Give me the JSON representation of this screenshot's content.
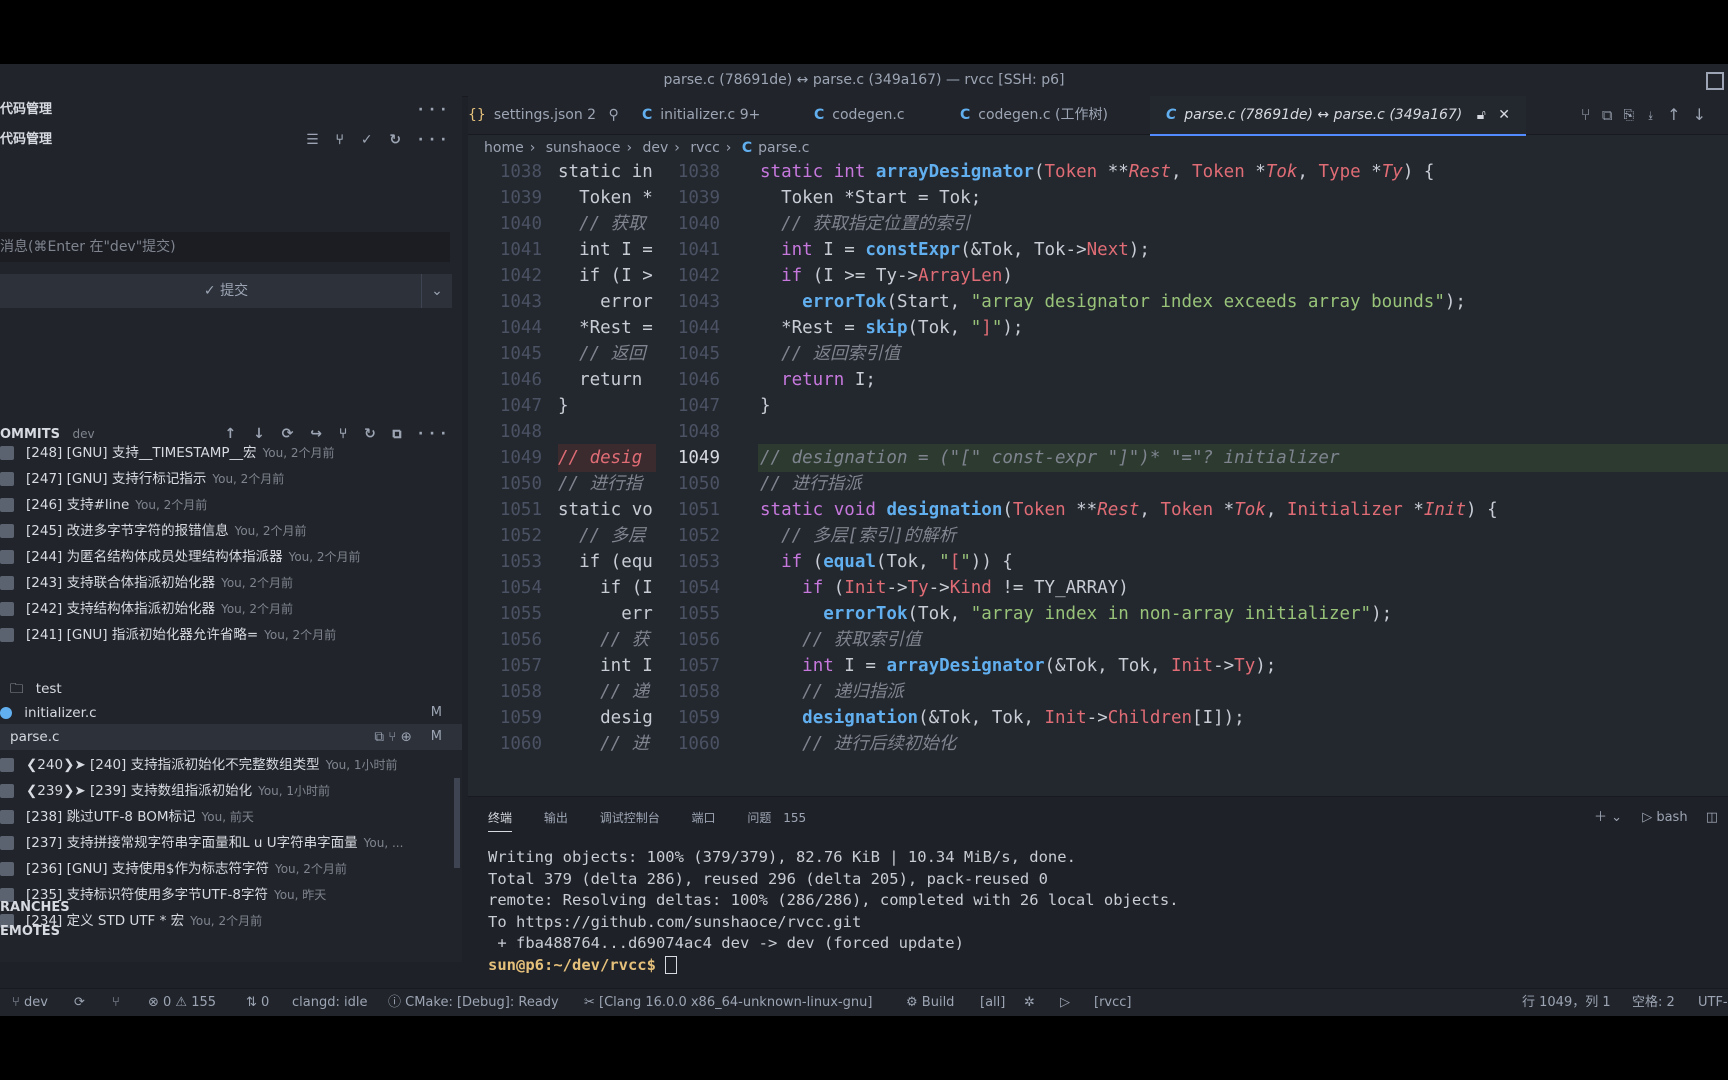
{
  "window": {
    "title": "parse.c (78691de) ↔ parse.c (349a167) — rvcc [SSH: p6]"
  },
  "sidebar": {
    "header": "代码管理",
    "section": "代码管理",
    "commit_placeholder": "消息(⌘Enter 在\"dev\"提交)",
    "commit_button": "✓ 提交",
    "commits_header": "OMMITS",
    "commits_branch": "dev",
    "commits": [
      {
        "text": "[248] [GNU] 支持__TIMESTAMP__宏",
        "meta": "You, 2个月前"
      },
      {
        "text": "[247] [GNU] 支持行标记指示",
        "meta": "You, 2个月前"
      },
      {
        "text": "[246] 支持#line",
        "meta": "You, 2个月前"
      },
      {
        "text": "[245] 改进多字节字符的报错信息",
        "meta": "You, 2个月前"
      },
      {
        "text": "[244] 为匿名结构体成员处理结构体指派器",
        "meta": "You, 2个月前"
      },
      {
        "text": "[243] 支持联合体指派初始化器",
        "meta": "You, 2个月前"
      },
      {
        "text": "[242] 支持结构体指派初始化器",
        "meta": "You, 2个月前"
      },
      {
        "text": "[241] [GNU] 指派初始化器允许省略=",
        "meta": "You, 2个月前"
      }
    ],
    "folder": "test",
    "file1": {
      "name": "initializer.c",
      "badge": "M"
    },
    "file2": {
      "name": "parse.c",
      "badge": "M"
    },
    "commits2": [
      {
        "text": "❮240❯➤ [240] 支持指派初始化不完整数组类型",
        "meta": "You, 1小时前"
      },
      {
        "text": "❮239❯➤ [239] 支持数组指派初始化",
        "meta": "You, 1小时前"
      },
      {
        "text": "[238] 跳过UTF-8 BOM标记",
        "meta": "You, 前天"
      },
      {
        "text": "[237] 支持拼接常规字符串字面量和L u U字符串字面量",
        "meta": "You, ..."
      },
      {
        "text": "[236] [GNU] 支持使用$作为标志符字符",
        "meta": "You, 2个月前"
      },
      {
        "text": "[235] 支持标识符使用多字节UTF-8字符",
        "meta": "You, 昨天"
      },
      {
        "text": "[234] 定义  STD UTF *  宏",
        "meta": "You, 2个月前"
      }
    ],
    "branches": "RANCHES",
    "remotes": "EMOTES"
  },
  "tabs": [
    {
      "icon": "{}",
      "label": "settings.json 2"
    },
    {
      "icon": "C",
      "label": "initializer.c 9+"
    },
    {
      "icon": "C",
      "label": "codegen.c"
    },
    {
      "icon": "C",
      "label": "codegen.c (工作树)"
    },
    {
      "icon": "C",
      "label": "parse.c (78691de) ↔ parse.c (349a167)"
    }
  ],
  "breadcrumb": [
    "home",
    "sunshaoce",
    "dev",
    "rvcc",
    "parse.c"
  ],
  "code": {
    "left": [
      {
        "n": "1038",
        "t": "static in"
      },
      {
        "n": "1039",
        "t": "  Token *"
      },
      {
        "n": "1040",
        "t": "  // 获取"
      },
      {
        "n": "1041",
        "t": "  int I ="
      },
      {
        "n": "1042",
        "t": "  if (I >"
      },
      {
        "n": "1043",
        "t": "    error"
      },
      {
        "n": "1044",
        "t": "  *Rest ="
      },
      {
        "n": "1045",
        "t": "  // 返回"
      },
      {
        "n": "1046",
        "t": "  return"
      },
      {
        "n": "1047",
        "t": "}"
      },
      {
        "n": "1048",
        "t": ""
      },
      {
        "n": "1049",
        "t": "// desig"
      },
      {
        "n": "1050",
        "t": "// 进行指"
      },
      {
        "n": "1051",
        "t": "static vo"
      },
      {
        "n": "1052",
        "t": "  // 多层"
      },
      {
        "n": "1053",
        "t": "  if (equ"
      },
      {
        "n": "1054",
        "t": "    if (I"
      },
      {
        "n": "1055",
        "t": "      err"
      },
      {
        "n": "1056",
        "t": "    // 获"
      },
      {
        "n": "1057",
        "t": "    int I"
      },
      {
        "n": "1058",
        "t": "    // 递"
      },
      {
        "n": "1059",
        "t": "    desig"
      },
      {
        "n": "1060",
        "t": "    // 进"
      }
    ],
    "right_numbers": [
      "1038",
      "1039",
      "1040",
      "1041",
      "1042",
      "1043",
      "1044",
      "1045",
      "1046",
      "1047",
      "1048",
      "1049",
      "1050",
      "1051",
      "1052",
      "1053",
      "1054",
      "1055",
      "1056",
      "1057",
      "1058",
      "1059",
      "1060"
    ]
  },
  "panel": {
    "tabs": [
      "终端",
      "输出",
      "调试控制台",
      "端口",
      "问题"
    ],
    "problems_count": "155",
    "shell": "bash",
    "terminal": [
      "Writing objects: 100% (379/379), 82.76 KiB | 10.34 MiB/s, done.",
      "Total 379 (delta 286), reused 296 (delta 205), pack-reused 0",
      "remote: Resolving deltas: 100% (286/286), completed with 26 local objects.",
      "To https://github.com/sunshaoce/rvcc.git",
      " + fba488764...d69074ac4 dev -> dev (forced update)"
    ],
    "prompt": "sun@p6:~/dev/rvcc$"
  },
  "status": {
    "branch": "dev",
    "errors": "⊗ 0 ⚠ 155",
    "ports": "0",
    "clangd": "clangd: idle",
    "cmake": "CMake: [Debug]: Ready",
    "kit": "[Clang 16.0.0 x86_64-unknown-linux-gnu]",
    "build": "Build",
    "target": "[all]",
    "project": "[rvcc]",
    "position": "行 1049，列 1",
    "spaces": "空格: 2",
    "encoding": "UTF-"
  }
}
